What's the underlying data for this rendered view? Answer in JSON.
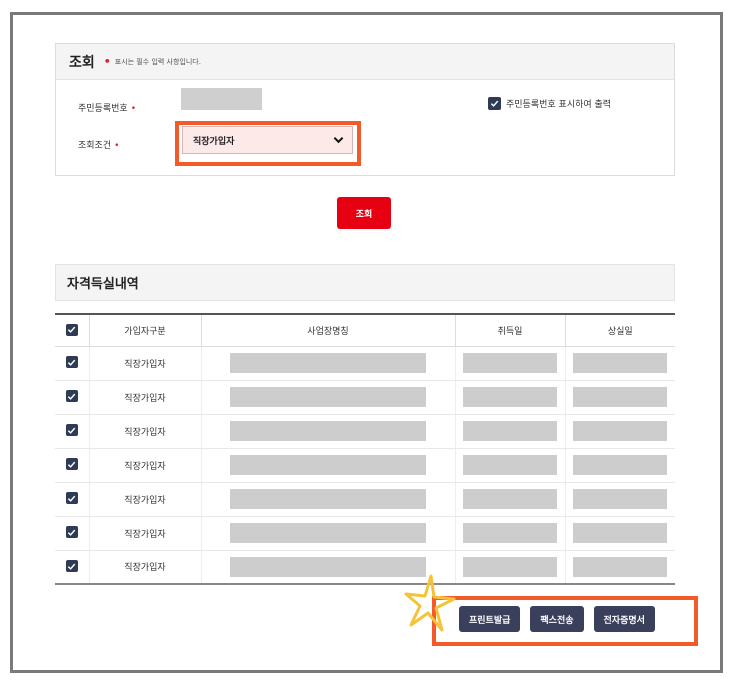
{
  "search": {
    "title": "조회",
    "req_marker": "•",
    "note": "표시는 필수 입력 사항입니다.",
    "resident_label": "주민등록번호",
    "condition_label": "조회조건",
    "required_star": "•",
    "show_resident_label": "주민등록번호 표시하여 출력",
    "show_resident_checked": true,
    "condition_value": "직장가입자",
    "search_button": "조회"
  },
  "result": {
    "title": "자격득실내역",
    "columns": [
      "가입자구분",
      "사업장명칭",
      "취득일",
      "상실일"
    ],
    "rows": [
      {
        "type": "직장가입자",
        "checked": true
      },
      {
        "type": "직장가입자",
        "checked": true
      },
      {
        "type": "직장가입자",
        "checked": true
      },
      {
        "type": "직장가입자",
        "checked": true
      },
      {
        "type": "직장가입자",
        "checked": true
      },
      {
        "type": "직장가입자",
        "checked": true
      },
      {
        "type": "직장가입자",
        "checked": true
      }
    ]
  },
  "actions": {
    "print_label": "프린트발급",
    "fax_label": "팩스전송",
    "e_cert_label": "전자증명서"
  },
  "colors": {
    "accent_red": "#e60012",
    "highlight_orange": "#f25a2a",
    "dark_button": "#3a3f5c",
    "checkbox": "#2e3b55",
    "star": "#f6c338"
  },
  "icons": [
    "check-icon",
    "chevron-down-icon",
    "star-doodle-icon"
  ]
}
